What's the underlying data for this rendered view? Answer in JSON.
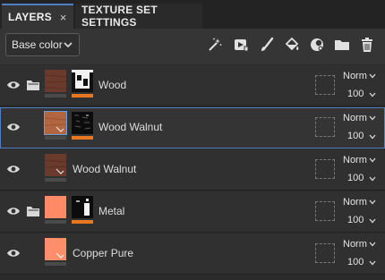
{
  "tabs": [
    {
      "label": "LAYERS",
      "close": "×"
    },
    {
      "label": "TEXTURE SET SETTINGS"
    }
  ],
  "toolbar": {
    "channel_dropdown": {
      "value": "Base color"
    },
    "tools": [
      "magic-wand-icon",
      "fill-effect-icon",
      "paint-brush-icon",
      "paint-bucket-icon",
      "smart-material-icon",
      "folder-icon",
      "trash-icon"
    ]
  },
  "colors": {
    "accent": "#4f7fc4",
    "mask_indicator": "#e87722",
    "wood_thumb": "#6a3a2c",
    "wood_walnut_thumb": "#b2663f",
    "metal_thumb": "#ff8a65",
    "copper_thumb": "#ff8f6b"
  },
  "layers": [
    {
      "name": "Wood",
      "type": "folder",
      "blend": "Norm",
      "opacity": "100",
      "selected": false
    },
    {
      "name": "Wood Walnut",
      "type": "layer",
      "blend": "Norm",
      "opacity": "100",
      "selected": true
    },
    {
      "name": "Wood Walnut",
      "type": "fill",
      "blend": "Norm",
      "opacity": "100",
      "selected": false
    },
    {
      "name": "Metal",
      "type": "folder",
      "blend": "Norm",
      "opacity": "100",
      "selected": false
    },
    {
      "name": "Copper Pure",
      "type": "fill",
      "blend": "Norm",
      "opacity": "100",
      "selected": false
    }
  ]
}
